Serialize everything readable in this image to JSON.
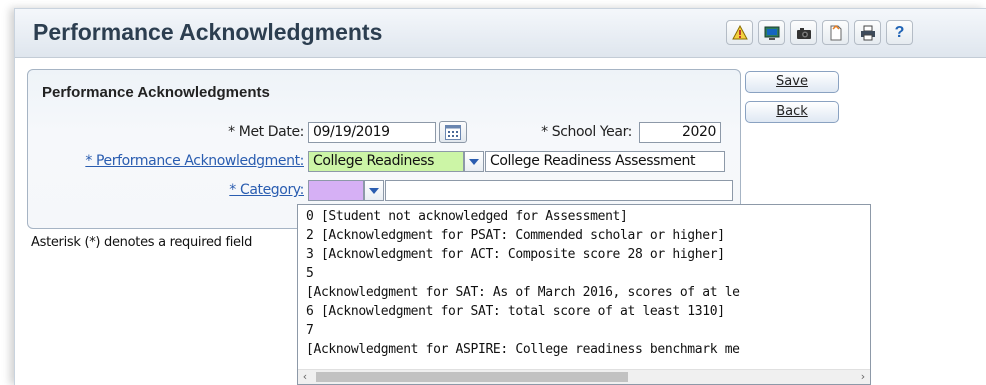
{
  "header": {
    "title": "Performance Acknowledgments",
    "toolbar": [
      {
        "name": "alert-icon"
      },
      {
        "name": "monitor-icon"
      },
      {
        "name": "camera-icon"
      },
      {
        "name": "document-icon"
      },
      {
        "name": "print-icon"
      },
      {
        "name": "help-icon",
        "label": "?"
      }
    ]
  },
  "panel": {
    "title": "Performance Acknowledgments",
    "met_date_label": "* Met Date:",
    "met_date_value": "09/19/2019",
    "school_year_label": "* School Year:",
    "school_year_value": "2020",
    "performance_ack_label": "* Performance Acknowledgment:",
    "performance_ack_value": "College Readiness",
    "performance_ack_desc": "College Readiness Assessment",
    "category_label": "* Category:",
    "category_value": ""
  },
  "actions": {
    "save_label": "Save",
    "back_label": "Back"
  },
  "note": "Asterisk (*) denotes a required field",
  "category_options": [
    "0 [Student not acknowledged for Assessment]",
    "2 [Acknowledgment for PSAT: Commended scholar or higher]",
    "3 [Acknowledgment for ACT: Composite score 28 or higher]",
    "5",
    "[Acknowledgment for SAT: As of March 2016, scores of at le",
    "6 [Acknowledgment for SAT: total score of at least 1310]",
    "7",
    "[Acknowledgment for ASPIRE: College readiness benchmark me"
  ],
  "colors": {
    "ack_highlight": "#ccf5a6",
    "category_highlight": "#d6b0f5",
    "link": "#2a5db0"
  }
}
